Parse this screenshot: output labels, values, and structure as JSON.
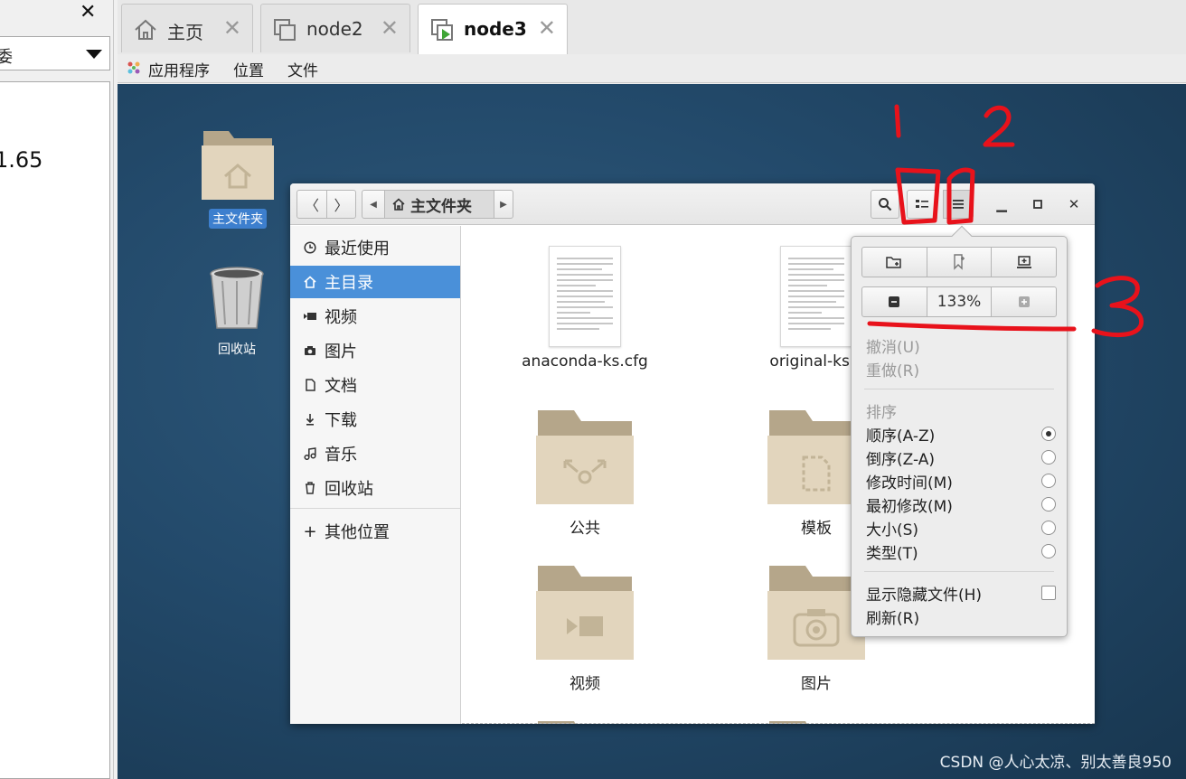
{
  "left_pane": {
    "combo_text": "委",
    "value_text": "1.65"
  },
  "tabs": [
    {
      "label": "主页",
      "icon": "home-icon"
    },
    {
      "label": "node2",
      "icon": "vm-icon"
    },
    {
      "label": "node3",
      "icon": "vm-running-icon",
      "active": true
    }
  ],
  "gnome_menu": [
    "应用程序",
    "位置",
    "文件"
  ],
  "desktop": {
    "home_label": "主文件夹",
    "trash_label": "回收站",
    "watermark": "CSDN @人心太凉、别太善良950"
  },
  "nautilus": {
    "path_current": "主文件夹",
    "sidebar": [
      {
        "label": "最近使用",
        "icon": "clock-icon"
      },
      {
        "label": "主目录",
        "icon": "home-icon",
        "active": true
      },
      {
        "label": "视频",
        "icon": "video-icon"
      },
      {
        "label": "图片",
        "icon": "camera-icon"
      },
      {
        "label": "文档",
        "icon": "document-icon"
      },
      {
        "label": "下载",
        "icon": "download-icon"
      },
      {
        "label": "音乐",
        "icon": "music-icon"
      },
      {
        "label": "回收站",
        "icon": "trash-icon"
      },
      {
        "label": "其他位置",
        "icon": "plus-icon"
      }
    ],
    "files": [
      {
        "label": "anaconda-ks.cfg",
        "kind": "document"
      },
      {
        "label": "original-ks.c",
        "kind": "document"
      },
      {
        "label": "公共",
        "kind": "folder-share"
      },
      {
        "label": "模板",
        "kind": "folder-template"
      },
      {
        "label": "视频",
        "kind": "folder-video"
      },
      {
        "label": "图片",
        "kind": "folder-camera"
      }
    ]
  },
  "popover": {
    "zoom_level": "133%",
    "undo": "撤消(U)",
    "redo": "重做(R)",
    "sort_header": "排序",
    "sort_options": [
      {
        "label": "顺序(A-Z)",
        "checked": true
      },
      {
        "label": "倒序(Z-A)",
        "checked": false
      },
      {
        "label": "修改时间(M)",
        "checked": false
      },
      {
        "label": "最初修改(M)",
        "checked": false
      },
      {
        "label": "大小(S)",
        "checked": false
      },
      {
        "label": "类型(T)",
        "checked": false
      }
    ],
    "show_hidden": "显示隐藏文件(H)",
    "refresh": "刷新(R)"
  },
  "annotations": {
    "label1": "1",
    "label2": "2",
    "label3": "3",
    "color": "#e8121b"
  }
}
